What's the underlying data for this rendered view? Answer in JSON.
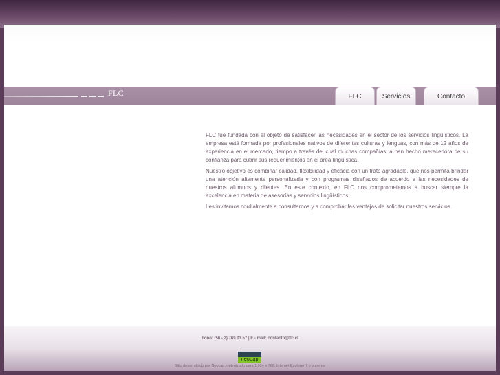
{
  "header": {
    "brand": "FLC"
  },
  "nav": {
    "tabs": [
      {
        "label": "FLC"
      },
      {
        "label": "Servicios"
      },
      {
        "label": "Contacto"
      }
    ]
  },
  "content": {
    "paragraphs": [
      "FLC fue fundada con el objeto de satisfacer las necesidades en el sector de los servicios lingüísticos. La empresa está formada por profesionales nativos de diferentes culturas y lenguas, con más de 12 años de experiencia en el mercado, tiempo a través del cual muchas compañías la han hecho merecedora de su confianza para cubrir sus requerimientos en el área lingüística.",
      "Nuestro objetivo es combinar calidad, flexibilidad y eficacia con un trato agradable, que nos permita brindar una atención altamente personalizada y con programas diseñados de acuerdo a las necesidades de nuestros alumnos y clientes. En este contexto, en FLC nos comprometemos a buscar siempre la excelencia en materia de asesorías y servicios lingüísticos.",
      "Les invitamos cordialmente a consultarnos y a comprobar las ventajas de solicitar nuestros servicios."
    ]
  },
  "footer": {
    "contact": "Fono: (56 - 2) 769 03 57 | E - mail: contacto@flc.cl",
    "neocap_logo_text": "neocap",
    "credit": "Sitio desarrollado por Neocap, optimizado para 1.024 x 768. Internet Explorer 7 o superior"
  },
  "colors": {
    "frame_background": "#5a3c58",
    "nav_bar": "#a890a6",
    "body_text": "#6e5c6c",
    "neocap_green": "#7ec326",
    "neocap_dark": "#2e4352"
  }
}
